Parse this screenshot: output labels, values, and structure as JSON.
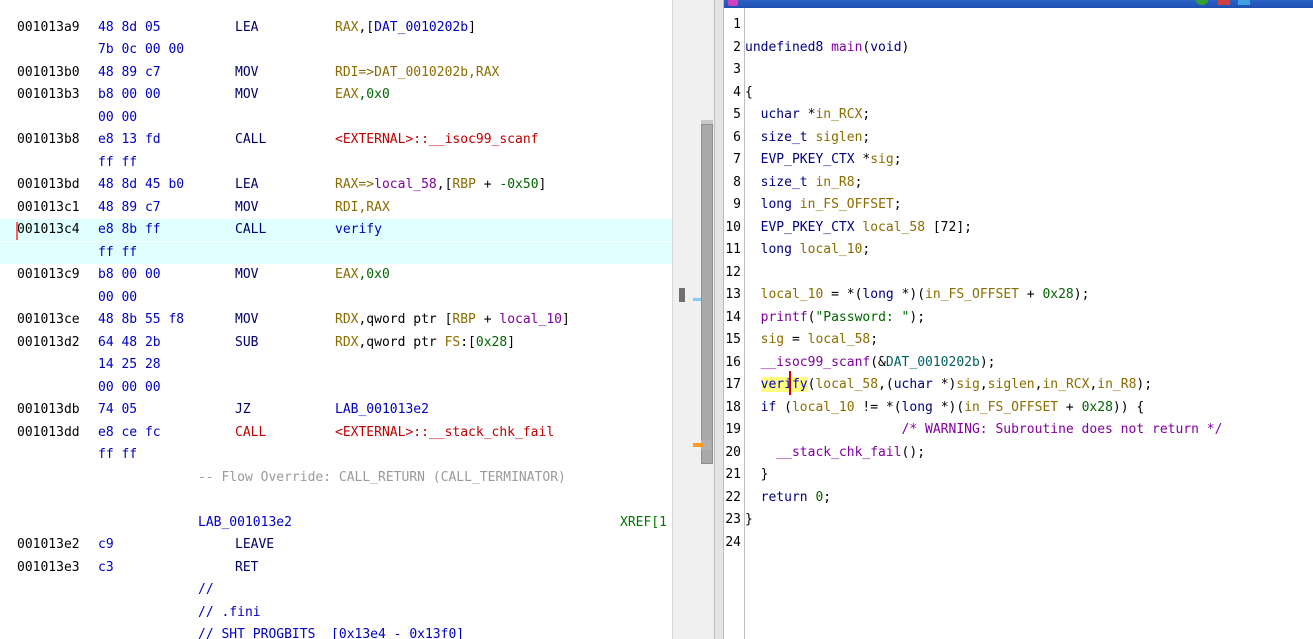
{
  "listing": {
    "rows": [
      {
        "addr": "001013a9",
        "bytes": "48 8d 05",
        "mnemonic": "LEA",
        "operands": [
          {
            "t": "RAX",
            "c": "reg"
          },
          {
            "t": ",[",
            "c": "plain"
          },
          {
            "t": "DAT_0010202b",
            "c": "addr"
          },
          {
            "t": "]",
            "c": "plain"
          }
        ]
      },
      {
        "addr": "",
        "bytes": "7b 0c 00 00",
        "mnemonic": "",
        "operands": []
      },
      {
        "addr": "001013b0",
        "bytes": "48 89 c7",
        "mnemonic": "MOV",
        "operands": [
          {
            "t": "RDI=>DAT_0010202b,RAX",
            "c": "reg"
          }
        ]
      },
      {
        "addr": "001013b3",
        "bytes": "b8 00 00",
        "mnemonic": "MOV",
        "operands": [
          {
            "t": "EAX",
            "c": "reg"
          },
          {
            "t": ",0x0",
            "c": "num"
          }
        ]
      },
      {
        "addr": "",
        "bytes": "00 00",
        "mnemonic": "",
        "operands": []
      },
      {
        "addr": "001013b8",
        "bytes": "e8 13 fd",
        "mnemonic": "CALL",
        "operands": [
          {
            "t": "<EXTERNAL>::__isoc99_scanf",
            "c": "ext"
          }
        ]
      },
      {
        "addr": "",
        "bytes": "ff ff",
        "mnemonic": "",
        "operands": []
      },
      {
        "addr": "001013bd",
        "bytes": "48 8d 45 b0",
        "mnemonic": "LEA",
        "operands": [
          {
            "t": "RAX=>",
            "c": "reg"
          },
          {
            "t": "local_58",
            "c": "loc"
          },
          {
            "t": ",[",
            "c": "plain"
          },
          {
            "t": "RBP",
            "c": "reg"
          },
          {
            "t": " + ",
            "c": "plain"
          },
          {
            "t": "-0x50",
            "c": "num"
          },
          {
            "t": "]",
            "c": "plain"
          }
        ]
      },
      {
        "addr": "001013c1",
        "bytes": "48 89 c7",
        "mnemonic": "MOV",
        "operands": [
          {
            "t": "RDI,RAX",
            "c": "reg"
          }
        ]
      },
      {
        "addr": "001013c4",
        "bytes": "e8 8b ff",
        "mnemonic": "CALL",
        "operands": [
          {
            "t": "verify",
            "c": "fn"
          }
        ],
        "highlight": true
      },
      {
        "addr": "",
        "bytes": "ff ff",
        "mnemonic": "",
        "operands": [],
        "highlight": true
      },
      {
        "addr": "001013c9",
        "bytes": "b8 00 00",
        "mnemonic": "MOV",
        "operands": [
          {
            "t": "EAX",
            "c": "reg"
          },
          {
            "t": ",0x0",
            "c": "num"
          }
        ]
      },
      {
        "addr": "",
        "bytes": "00 00",
        "mnemonic": "",
        "operands": []
      },
      {
        "addr": "001013ce",
        "bytes": "48 8b 55 f8",
        "mnemonic": "MOV",
        "operands": [
          {
            "t": "RDX",
            "c": "reg"
          },
          {
            "t": ",qword ptr [",
            "c": "plain"
          },
          {
            "t": "RBP",
            "c": "reg"
          },
          {
            "t": " + ",
            "c": "plain"
          },
          {
            "t": "local_10",
            "c": "loc"
          },
          {
            "t": "]",
            "c": "plain"
          }
        ]
      },
      {
        "addr": "001013d2",
        "bytes": "64 48 2b",
        "mnemonic": "SUB",
        "operands": [
          {
            "t": "RDX",
            "c": "reg"
          },
          {
            "t": ",qword ptr ",
            "c": "plain"
          },
          {
            "t": "FS",
            "c": "reg"
          },
          {
            "t": ":[",
            "c": "plain"
          },
          {
            "t": "0x28",
            "c": "num"
          },
          {
            "t": "]",
            "c": "plain"
          }
        ]
      },
      {
        "addr": "",
        "bytes": "14 25 28",
        "mnemonic": "",
        "operands": []
      },
      {
        "addr": "",
        "bytes": "00 00 00",
        "mnemonic": "",
        "operands": []
      },
      {
        "addr": "001013db",
        "bytes": "74 05",
        "mnemonic": "JZ",
        "operands": [
          {
            "t": "LAB_001013e2",
            "c": "addr"
          }
        ]
      },
      {
        "addr": "001013dd",
        "bytes": "e8 ce fc",
        "mnemonic": "CALL",
        "mnemonic_red": true,
        "operands": [
          {
            "t": "<EXTERNAL>::__stack_chk_fail",
            "c": "ext"
          }
        ]
      },
      {
        "addr": "",
        "bytes": "ff ff",
        "mnemonic": "",
        "operands": []
      },
      {
        "full": "-- Flow Override: CALL_RETURN (CALL_TERMINATOR)",
        "c": "cmt"
      },
      {
        "full": "",
        "c": "plain"
      },
      {
        "full": "LAB_001013e2",
        "c": "lbl",
        "xref": "XREF[1"
      },
      {
        "addr": "001013e2",
        "bytes": "c9",
        "mnemonic": "LEAVE",
        "operands": []
      },
      {
        "addr": "001013e3",
        "bytes": "c3",
        "mnemonic": "RET",
        "operands": []
      },
      {
        "full": "//",
        "c": "lbl"
      },
      {
        "full": "// .fini",
        "c": "lbl"
      },
      {
        "full": "// SHT_PROGBITS  [0x13e4 - 0x13f0]",
        "c": "lbl"
      }
    ]
  },
  "decompiler": {
    "lines": [
      [],
      [
        {
          "t": "undefined8 ",
          "c": "ty"
        },
        {
          "t": "main",
          "c": "fnm"
        },
        {
          "t": "(",
          "c": "pl"
        },
        {
          "t": "void",
          "c": "ty"
        },
        {
          "t": ")",
          "c": "pl"
        }
      ],
      [],
      [
        {
          "t": "{",
          "c": "pl"
        }
      ],
      [
        {
          "t": "  uchar ",
          "c": "ty"
        },
        {
          "t": "*",
          "c": "pl"
        },
        {
          "t": "in_RCX",
          "c": "vr"
        },
        {
          "t": ";",
          "c": "pl"
        }
      ],
      [
        {
          "t": "  size_t ",
          "c": "ty"
        },
        {
          "t": "siglen",
          "c": "vr"
        },
        {
          "t": ";",
          "c": "pl"
        }
      ],
      [
        {
          "t": "  EVP_PKEY_CTX ",
          "c": "ty"
        },
        {
          "t": "*",
          "c": "pl"
        },
        {
          "t": "sig",
          "c": "vr"
        },
        {
          "t": ";",
          "c": "pl"
        }
      ],
      [
        {
          "t": "  size_t ",
          "c": "ty"
        },
        {
          "t": "in_R8",
          "c": "vr"
        },
        {
          "t": ";",
          "c": "pl"
        }
      ],
      [
        {
          "t": "  long ",
          "c": "ty"
        },
        {
          "t": "in_FS_OFFSET",
          "c": "vr"
        },
        {
          "t": ";",
          "c": "pl"
        }
      ],
      [
        {
          "t": "  EVP_PKEY_CTX ",
          "c": "ty"
        },
        {
          "t": "local_58",
          "c": "vr"
        },
        {
          "t": " [72]",
          "c": "pl"
        },
        {
          "t": ";",
          "c": "pl"
        }
      ],
      [
        {
          "t": "  long ",
          "c": "ty"
        },
        {
          "t": "local_10",
          "c": "vr"
        },
        {
          "t": ";",
          "c": "pl"
        }
      ],
      [],
      [
        {
          "t": "  local_10",
          "c": "vr"
        },
        {
          "t": " = *(",
          "c": "pl"
        },
        {
          "t": "long",
          "c": "ty"
        },
        {
          "t": " *)(",
          "c": "pl"
        },
        {
          "t": "in_FS_OFFSET",
          "c": "vr"
        },
        {
          "t": " + ",
          "c": "pl"
        },
        {
          "t": "0x28",
          "c": "nm"
        },
        {
          "t": ");",
          "c": "pl"
        }
      ],
      [
        {
          "t": "  printf",
          "c": "fnm"
        },
        {
          "t": "(",
          "c": "pl"
        },
        {
          "t": "\"Password: \"",
          "c": "st"
        },
        {
          "t": ");",
          "c": "pl"
        }
      ],
      [
        {
          "t": "  sig",
          "c": "vr"
        },
        {
          "t": " = ",
          "c": "pl"
        },
        {
          "t": "local_58",
          "c": "vr"
        },
        {
          "t": ";",
          "c": "pl"
        }
      ],
      [
        {
          "t": "  __isoc99_scanf",
          "c": "fnm"
        },
        {
          "t": "(&",
          "c": "pl"
        },
        {
          "t": "DAT_0010202b",
          "c": "gl"
        },
        {
          "t": ");",
          "c": "pl"
        }
      ],
      [
        {
          "t": "  ",
          "c": "pl"
        },
        {
          "t": "verify",
          "c": "fn",
          "sel": true
        },
        {
          "t": "(",
          "c": "pl"
        },
        {
          "t": "local_58",
          "c": "vr"
        },
        {
          "t": ",(",
          "c": "pl"
        },
        {
          "t": "uchar",
          "c": "ty"
        },
        {
          "t": " *)",
          "c": "pl"
        },
        {
          "t": "sig",
          "c": "vr"
        },
        {
          "t": ",",
          "c": "pl"
        },
        {
          "t": "siglen",
          "c": "vr"
        },
        {
          "t": ",",
          "c": "pl"
        },
        {
          "t": "in_RCX",
          "c": "vr"
        },
        {
          "t": ",",
          "c": "pl"
        },
        {
          "t": "in_R8",
          "c": "vr"
        },
        {
          "t": ");",
          "c": "pl"
        }
      ],
      [
        {
          "t": "  if",
          "c": "k"
        },
        {
          "t": " (",
          "c": "pl"
        },
        {
          "t": "local_10",
          "c": "vr"
        },
        {
          "t": " != *(",
          "c": "pl"
        },
        {
          "t": "long",
          "c": "ty"
        },
        {
          "t": " *)(",
          "c": "pl"
        },
        {
          "t": "in_FS_OFFSET",
          "c": "vr"
        },
        {
          "t": " + ",
          "c": "pl"
        },
        {
          "t": "0x28",
          "c": "nm"
        },
        {
          "t": ")) {",
          "c": "pl"
        }
      ],
      [
        {
          "t": "                    /* WARNING: Subroutine does not return */",
          "c": "wn"
        }
      ],
      [
        {
          "t": "    __stack_chk_fail",
          "c": "fnm"
        },
        {
          "t": "();",
          "c": "pl"
        }
      ],
      [
        {
          "t": "  }",
          "c": "pl"
        }
      ],
      [
        {
          "t": "  return ",
          "c": "k"
        },
        {
          "t": "0",
          "c": "nm"
        },
        {
          "t": ";",
          "c": "pl"
        }
      ],
      [
        {
          "t": "}",
          "c": "pl"
        }
      ],
      []
    ]
  }
}
